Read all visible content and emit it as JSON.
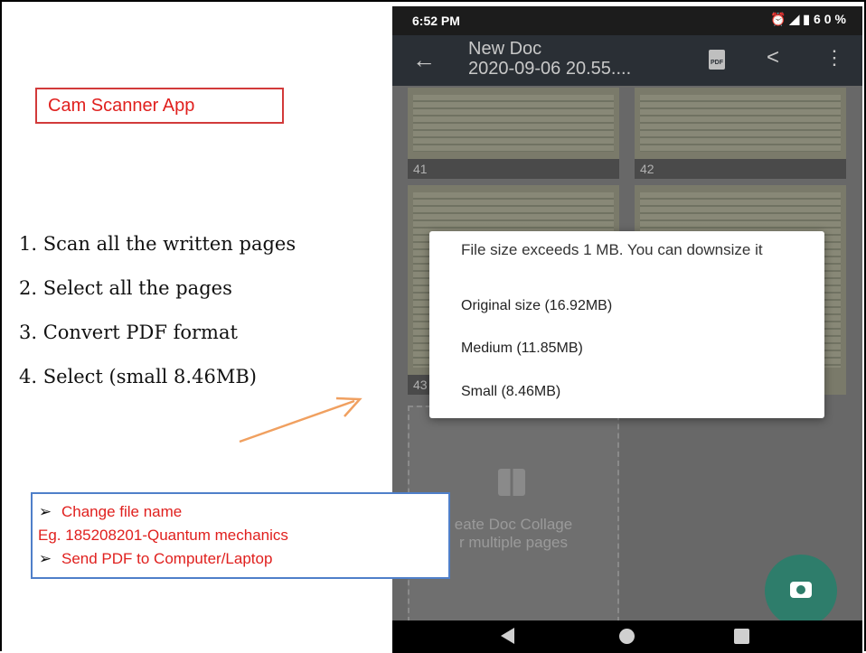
{
  "slide": {
    "title": "Cam Scanner App",
    "steps": [
      "1. Scan all the written pages",
      "2. Select all the pages",
      "3. Convert PDF format",
      "4. Select (small 8.46MB)"
    ],
    "notes": {
      "line1": "Change file name",
      "line2": "Eg. 185208201-Quantum mechanics",
      "line3": "Send PDF to Computer/Laptop",
      "bullet": "➢"
    }
  },
  "phone": {
    "status": {
      "time": "6:52 PM",
      "battery": "60%"
    },
    "appbar": {
      "title_line1": "New Doc",
      "title_line2": "2020-09-06 20.55....",
      "pdf_icon_label": "PDF"
    },
    "pages": [
      "41",
      "42",
      "43"
    ],
    "collage_text": [
      "eate Doc Collage",
      "r multiple pages"
    ],
    "dialog": {
      "title": "File size exceeds 1 MB. You can downsize it",
      "options": [
        "Original size (16.92MB)",
        "Medium (11.85MB)",
        "Small (8.46MB)"
      ]
    }
  },
  "colors": {
    "accent_red": "#e0201e",
    "note_border": "#4f7fc9",
    "arrow_orange": "#f0a060",
    "fab_green": "#2e7d6b"
  }
}
